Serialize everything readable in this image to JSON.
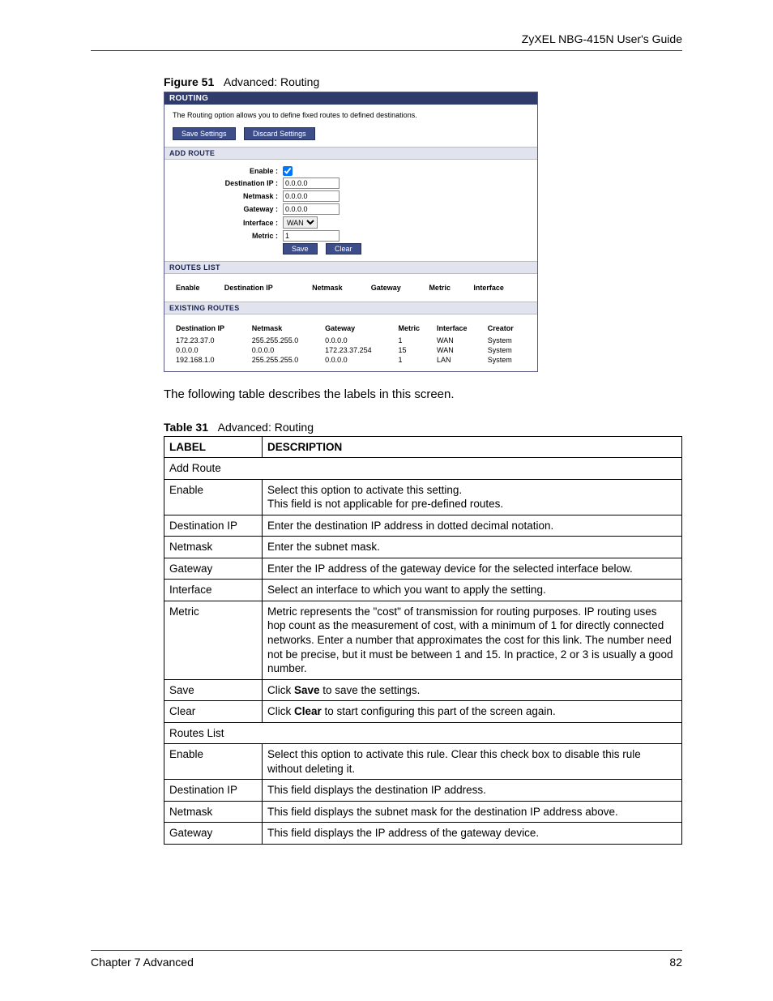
{
  "header": {
    "guide_title": "ZyXEL NBG-415N User's Guide"
  },
  "figure": {
    "label": "Figure 51",
    "title": "Advanced: Routing"
  },
  "router_ui": {
    "title": "ROUTING",
    "desc": "The Routing option allows you to define fixed routes to defined destinations.",
    "save_btn": "Save Settings",
    "discard_btn": "Discard Settings",
    "add_route_header": "ADD ROUTE",
    "form": {
      "enable_label": "Enable :",
      "enable_checked": true,
      "dest_ip_label": "Destination IP :",
      "dest_ip": "0.0.0.0",
      "netmask_label": "Netmask :",
      "netmask": "0.0.0.0",
      "gateway_label": "Gateway :",
      "gateway": "0.0.0.0",
      "interface_label": "Interface :",
      "interface": "WAN",
      "metric_label": "Metric :",
      "metric": "1",
      "save_btn": "Save",
      "clear_btn": "Clear"
    },
    "routes_list": {
      "header": "ROUTES LIST",
      "cols": {
        "enable": "Enable",
        "dest_ip": "Destination IP",
        "netmask": "Netmask",
        "gateway": "Gateway",
        "metric": "Metric",
        "interface": "Interface"
      }
    },
    "existing_routes": {
      "header": "EXISTING ROUTES",
      "cols": {
        "dest_ip": "Destination IP",
        "netmask": "Netmask",
        "gateway": "Gateway",
        "metric": "Metric",
        "interface": "Interface",
        "creator": "Creator"
      },
      "rows": [
        {
          "dest_ip": "172.23.37.0",
          "netmask": "255.255.255.0",
          "gateway": "0.0.0.0",
          "metric": "1",
          "interface": "WAN",
          "creator": "System"
        },
        {
          "dest_ip": "0.0.0.0",
          "netmask": "0.0.0.0",
          "gateway": "172.23.37.254",
          "metric": "15",
          "interface": "WAN",
          "creator": "System"
        },
        {
          "dest_ip": "192.168.1.0",
          "netmask": "255.255.255.0",
          "gateway": "0.0.0.0",
          "metric": "1",
          "interface": "LAN",
          "creator": "System"
        }
      ]
    }
  },
  "body_text": "The following table describes the labels in this screen.",
  "table31": {
    "label": "Table 31",
    "title": "Advanced: Routing",
    "col_label": "LABEL",
    "col_desc": "DESCRIPTION",
    "rows": [
      {
        "label": "Add Route",
        "desc": "",
        "span": true
      },
      {
        "label": "Enable",
        "desc": "Select this option to activate this setting.\nThis field is not applicable for pre-defined routes."
      },
      {
        "label": "Destination IP",
        "desc": "Enter the destination IP address in dotted decimal notation."
      },
      {
        "label": "Netmask",
        "desc": "Enter the subnet mask."
      },
      {
        "label": "Gateway",
        "desc": "Enter the IP address of the gateway device for the selected interface below."
      },
      {
        "label": "Interface",
        "desc": "Select an interface to which you want to apply the setting."
      },
      {
        "label": "Metric",
        "desc": "Metric represents the \"cost\" of transmission for routing purposes. IP routing uses hop count as the measurement of cost, with a minimum of 1 for directly connected networks. Enter a number that approximates the cost for this link. The number need not be precise, but it must be between 1 and 15. In practice, 2 or 3 is usually a good number."
      },
      {
        "label": "Save",
        "desc_pre": "Click ",
        "desc_bold": "Save",
        "desc_post": " to save the settings.",
        "rich": true
      },
      {
        "label": "Clear",
        "desc_pre": "Click ",
        "desc_bold": "Clear",
        "desc_post": " to start configuring this part of the screen again.",
        "rich": true
      },
      {
        "label": "Routes List",
        "desc": "",
        "span": true
      },
      {
        "label": "Enable",
        "desc": "Select this option to activate this rule. Clear this check box to disable this rule without deleting it."
      },
      {
        "label": "Destination IP",
        "desc": "This field displays the destination IP address."
      },
      {
        "label": "Netmask",
        "desc": "This field displays the subnet mask for the destination IP address above."
      },
      {
        "label": "Gateway",
        "desc": "This field displays the IP address of the gateway device."
      }
    ]
  },
  "footer": {
    "chapter": "Chapter 7 Advanced",
    "page": "82"
  }
}
